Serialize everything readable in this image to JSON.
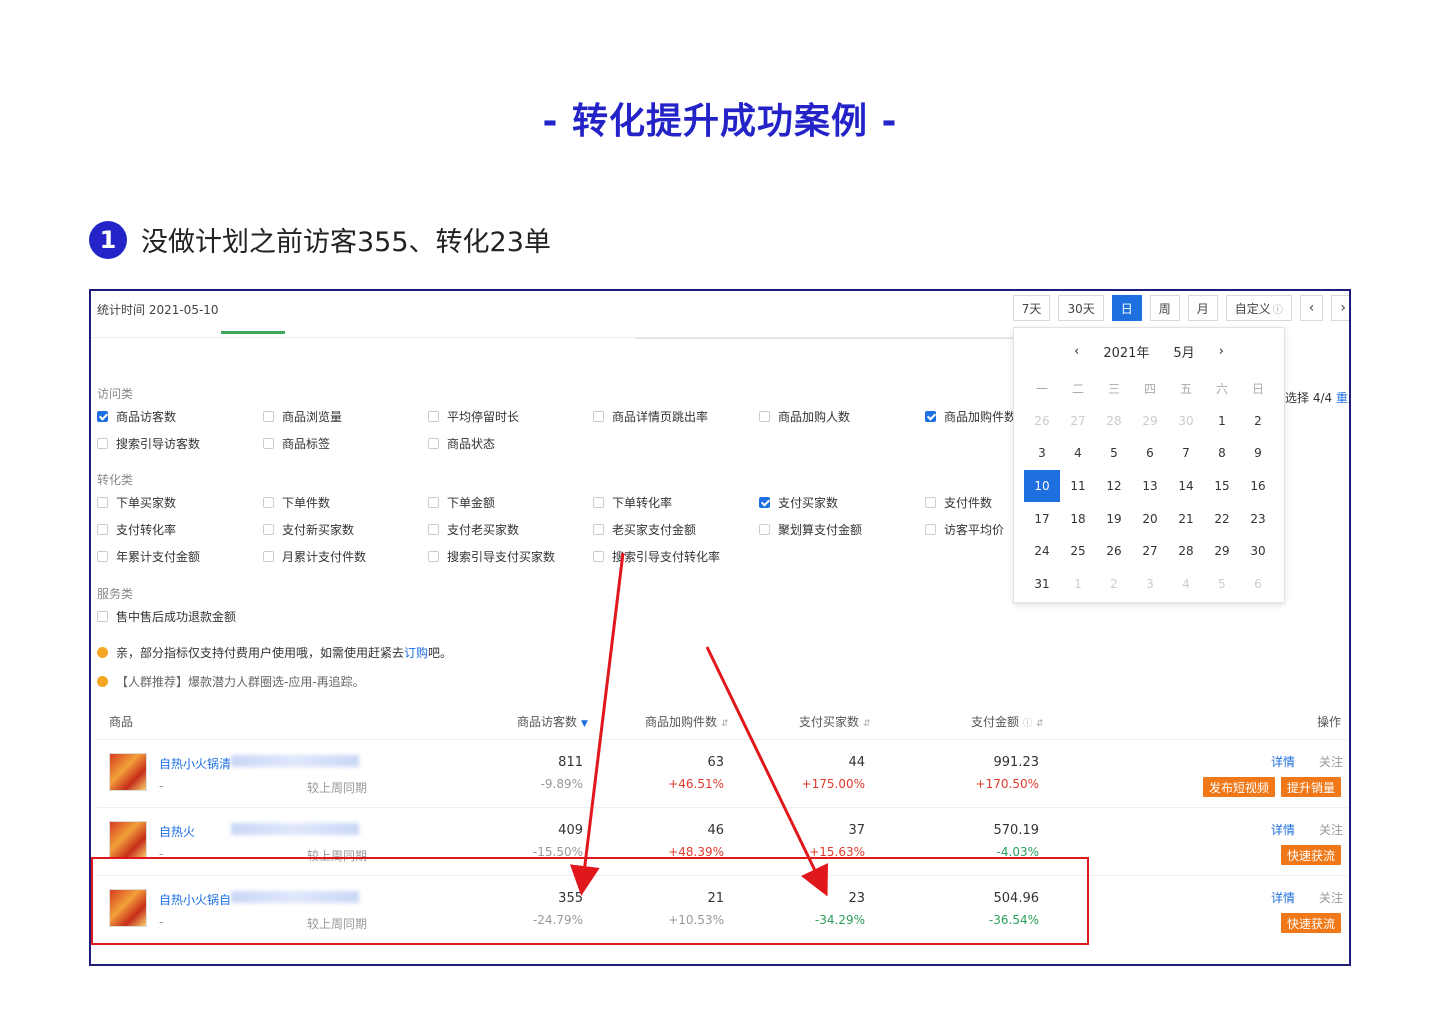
{
  "page": {
    "title": "- 转化提升成功案例 -",
    "step_number": "1",
    "step_text": "没做计划之前访客355、转化23单"
  },
  "colors": {
    "accent": "#2323c8",
    "primary": "#1e6fe0",
    "up": "#e23b2e",
    "down": "#2aa05b",
    "highlight": "#e0181c",
    "button": "#f07818"
  },
  "header": {
    "stat_time": "统计时间 2021-05-10",
    "range_tabs": [
      "7天",
      "30天",
      "日",
      "周",
      "月",
      "自定义",
      "‹",
      "›"
    ],
    "active_tab": "日"
  },
  "metrics": {
    "visit_label": "访问类",
    "visit": [
      {
        "label": "商品访客数",
        "checked": true
      },
      {
        "label": "商品浏览量",
        "checked": false
      },
      {
        "label": "平均停留时长",
        "checked": false
      },
      {
        "label": "商品详情页跳出率",
        "checked": false
      },
      {
        "label": "商品加购人数",
        "checked": false
      },
      {
        "label": "商品加购件数",
        "checked": true
      },
      {
        "label": "搜索引导访客数",
        "checked": false
      },
      {
        "label": "商品标签",
        "checked": false
      },
      {
        "label": "商品状态",
        "checked": false
      }
    ],
    "convert_label": "转化类",
    "convert": [
      {
        "label": "下单买家数",
        "checked": false
      },
      {
        "label": "下单件数",
        "checked": false
      },
      {
        "label": "下单金额",
        "checked": false
      },
      {
        "label": "下单转化率",
        "checked": false
      },
      {
        "label": "支付买家数",
        "checked": true
      },
      {
        "label": "支付件数",
        "checked": false
      },
      {
        "label": "支付转化率",
        "checked": false
      },
      {
        "label": "支付新买家数",
        "checked": false
      },
      {
        "label": "支付老买家数",
        "checked": false
      },
      {
        "label": "老买家支付金额",
        "checked": false
      },
      {
        "label": "聚划算支付金额",
        "checked": false
      },
      {
        "label": "访客平均价",
        "checked": false
      },
      {
        "label": "年累计支付金额",
        "checked": false
      },
      {
        "label": "月累计支付件数",
        "checked": false
      },
      {
        "label": "搜索引导支付买家数",
        "checked": false
      },
      {
        "label": "搜索引导支付转化率",
        "checked": false
      }
    ],
    "service_label": "服务类",
    "service": [
      {
        "label": "售中售后成功退款金额",
        "checked": false
      }
    ],
    "selected_info": "选择 4/4",
    "reset_label": "重置"
  },
  "notes": {
    "note1_text": "亲，部分指标仅支持付费用户使用哦，如需使用赶紧去",
    "note1_link": "订购",
    "note1_tail": "吧。",
    "note2_text": "【人群推荐】爆款潜力人群圈选-应用-再追踪。"
  },
  "calendar": {
    "year": "2021年",
    "month": "5月",
    "prev": "‹",
    "next": "›",
    "weekdays": [
      "一",
      "二",
      "三",
      "四",
      "五",
      "六",
      "日"
    ],
    "days": [
      [
        "26",
        "27",
        "28",
        "29",
        "30",
        "1",
        "2"
      ],
      [
        "3",
        "4",
        "5",
        "6",
        "7",
        "8",
        "9"
      ],
      [
        "10",
        "11",
        "12",
        "13",
        "14",
        "15",
        "16"
      ],
      [
        "17",
        "18",
        "19",
        "20",
        "21",
        "22",
        "23"
      ],
      [
        "24",
        "25",
        "26",
        "27",
        "28",
        "29",
        "30"
      ],
      [
        "31",
        "1",
        "2",
        "3",
        "4",
        "5",
        "6"
      ]
    ],
    "selected": "10"
  },
  "table": {
    "headers": {
      "product": "商品",
      "visitors": "商品访客数",
      "cart": "商品加购件数",
      "buyers": "支付买家数",
      "amount": "支付金额",
      "ops": "操作"
    },
    "compare_label": "较上周同期",
    "rows": [
      {
        "name": "自热小火锅清",
        "dash": "-",
        "visitors": "811",
        "visitors_pct": "-9.89%",
        "cart": "63",
        "cart_pct": "+46.51%",
        "buyers": "44",
        "buyers_pct": "+175.00%",
        "amount": "991.23",
        "amount_pct": "+170.50%",
        "detail": "详情",
        "follow": "关注",
        "buttons": [
          "发布短视频",
          "提升销量"
        ]
      },
      {
        "name": "自热火",
        "dash": "-",
        "visitors": "409",
        "visitors_pct": "-15.50%",
        "cart": "46",
        "cart_pct": "+48.39%",
        "buyers": "37",
        "buyers_pct": "+15.63%",
        "amount": "570.19",
        "amount_pct": "-4.03%",
        "detail": "详情",
        "follow": "关注",
        "buttons": [
          "快速获流"
        ]
      },
      {
        "name": "自热小火锅自",
        "dash": "-",
        "visitors": "355",
        "visitors_pct": "-24.79%",
        "cart": "21",
        "cart_pct": "+10.53%",
        "buyers": "23",
        "buyers_pct": "-34.29%",
        "amount": "504.96",
        "amount_pct": "-36.54%",
        "detail": "详情",
        "follow": "关注",
        "buttons": [
          "快速获流"
        ]
      }
    ]
  }
}
